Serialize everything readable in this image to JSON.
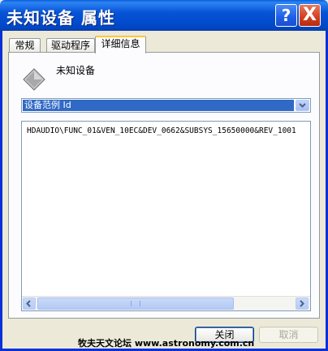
{
  "window": {
    "title": "未知设备 属性",
    "help_symbol": "?",
    "close_symbol": "X"
  },
  "tabs": [
    {
      "label": "常规"
    },
    {
      "label": "驱动程序"
    },
    {
      "label": "详细信息"
    }
  ],
  "device": {
    "name": "未知设备",
    "icon": "unknown-device-icon"
  },
  "property_select": {
    "selected": "设备范例 Id"
  },
  "value_list": {
    "items": [
      "HDAUDIO\\FUNC_01&VEN_10EC&DEV_0662&SUBSYS_15650000&REV_1001"
    ]
  },
  "buttons": {
    "close_label": "关闭",
    "cancel_label": "取消"
  },
  "watermark": "牧夫天文论坛 www.astronomy.com.cn",
  "colors": {
    "title_bar": "#0054e3",
    "selection": "#316ac5",
    "active_tab_accent": "#ffc73c"
  }
}
